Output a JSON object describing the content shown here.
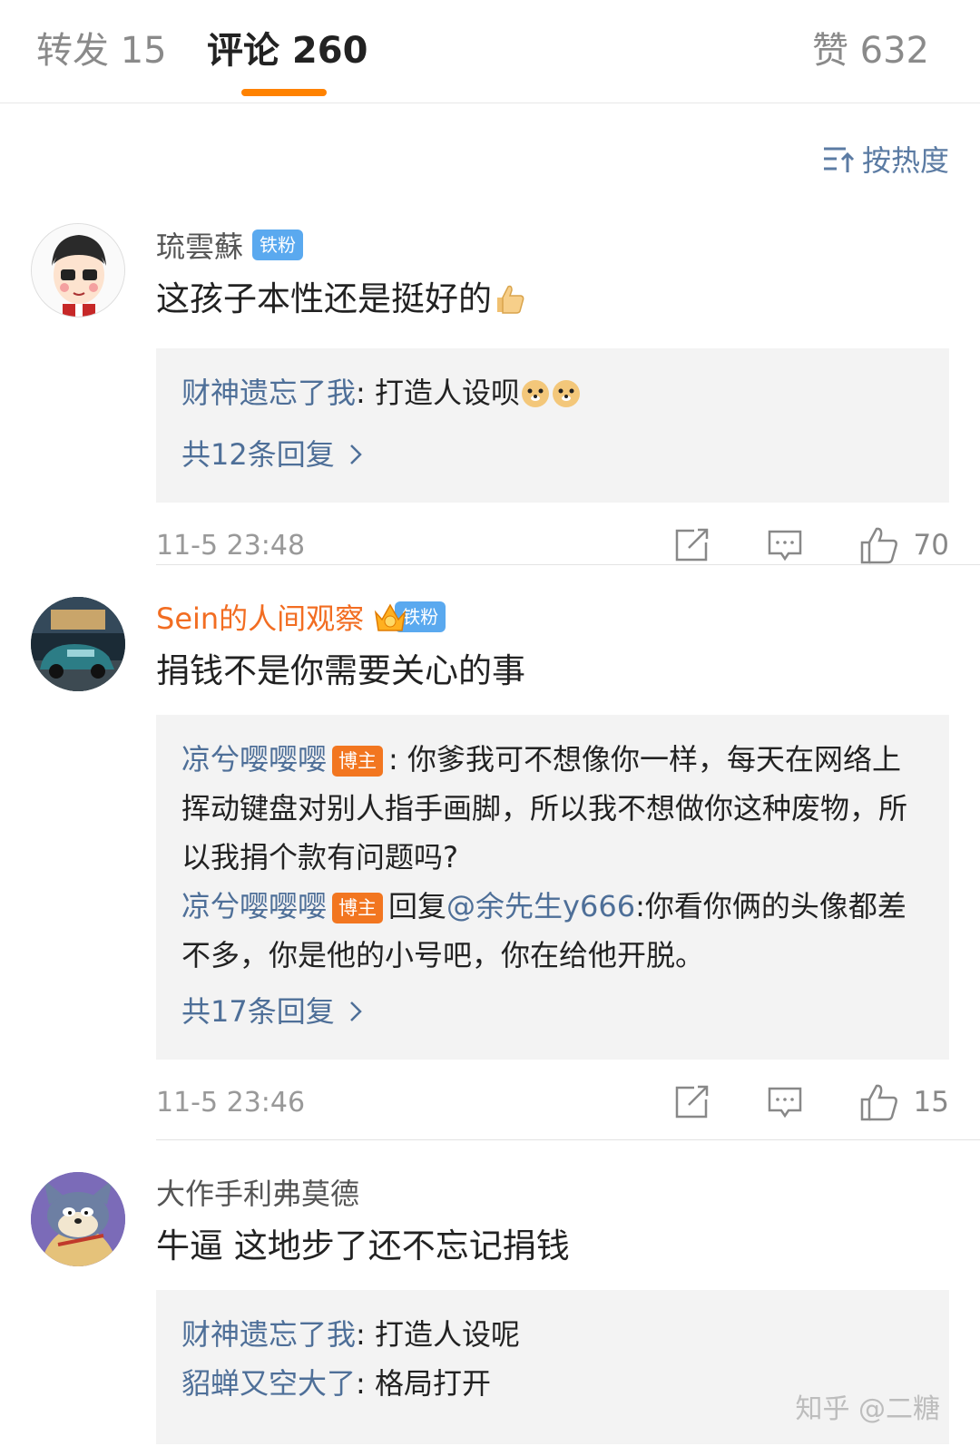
{
  "tabs": {
    "repost": "转发 15",
    "comment": "评论 260",
    "like": "赞 632"
  },
  "sort": {
    "label": "按热度"
  },
  "comments": [
    {
      "user": "琉雲蘇",
      "badge": "铁粉",
      "text": "这孩子本性还是挺好的",
      "emoji": "thumbs-up-emoji",
      "replies": [
        {
          "name": "财神遗忘了我",
          "text": ": 打造人设呗"
        }
      ],
      "more": "共12条回复",
      "time": "11-5 23:48",
      "likes": "70"
    },
    {
      "user": "Sein的人间观察",
      "badge": "铁粉",
      "text": "捐钱不是你需要关心的事",
      "replies": [
        {
          "name": "凉兮嘤嘤嘤",
          "host_badge": "博主",
          "text": ": 你爹我可不想像你一样，每天在网络上挥动键盘对别人指手画脚，所以我不想做你这种废物，所以我捐个款有问题吗?"
        },
        {
          "name": "凉兮嘤嘤嘤",
          "host_badge": "博主",
          "reply_word": "回复",
          "mention": "@余先生y666",
          "text": ":你看你俩的头像都差不多，你是他的小号吧，你在给他开脱。"
        }
      ],
      "more": "共17条回复",
      "time": "11-5 23:46",
      "likes": "15"
    },
    {
      "user": "大作手利弗莫德",
      "text": "牛逼 这地步了还不忘记捐钱",
      "replies": [
        {
          "name": "财神遗忘了我",
          "text": ": 打造人设呢"
        },
        {
          "name": "貂蝉又空大了",
          "text": ": 格局打开"
        }
      ]
    }
  ],
  "watermark": "知乎 @二糖",
  "colors": {
    "accent": "#ff8200",
    "link": "#4e6f98",
    "fan_badge": "#5aa9ef",
    "host_badge": "#f27620"
  }
}
